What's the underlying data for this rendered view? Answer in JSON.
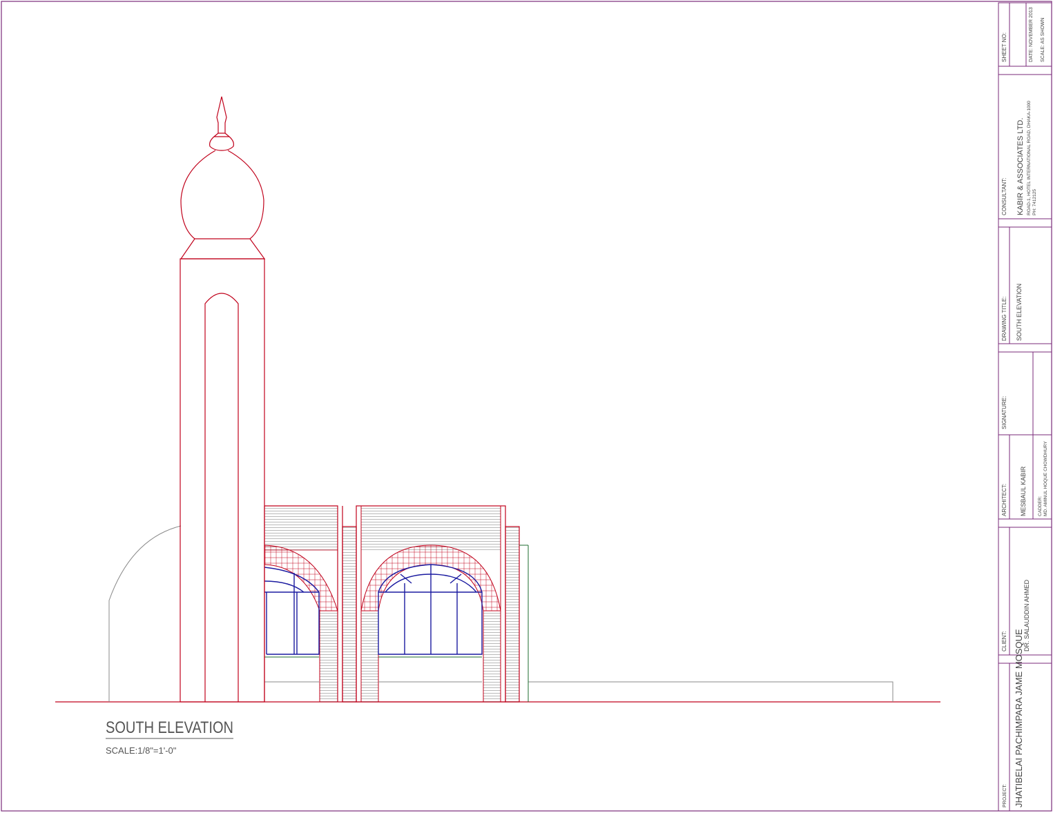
{
  "drawing": {
    "title": "SOUTH ELEVATION",
    "scale": "SCALE:1/8\"=1'-0\""
  },
  "title_block": {
    "sheet": {
      "label": "SHEET NO:",
      "date": "DATE: NOVEMBER 2013",
      "scale": "SCALE: AS SHOWN"
    },
    "consultant": {
      "label": "CONSULTANT:",
      "name": "KABIR & ASSOCIATES LTD.",
      "address": "ROAD-1, HOTEL INTERNATIONAL ROAD, DHAKA-1000",
      "phone": "PH: 7412125"
    },
    "drawing_title": {
      "label": "DRAWING TITLE:",
      "value": "SOUTH ELEVATION"
    },
    "signature": {
      "label": "SIGNATURE:"
    },
    "architect": {
      "label": "ARCHITECT:",
      "name": "MESBAUL KABIR",
      "cad_label": "CADDER:",
      "cad_name": "MD. AMINUL HOQUE CHOWDHURY"
    },
    "client": {
      "label": "CLIENT:",
      "name": "DR. SALAUDDIN AHMED"
    },
    "project": {
      "label": "PROJECT:",
      "name": "JHATIBELAI PACHIMPARA JAME MOSQUE"
    }
  },
  "colors": {
    "border": "#7a2a7a",
    "structure": "#c0001a",
    "window": "#1a1aa0",
    "outline": "#777777",
    "green": "#1e6b2e"
  }
}
